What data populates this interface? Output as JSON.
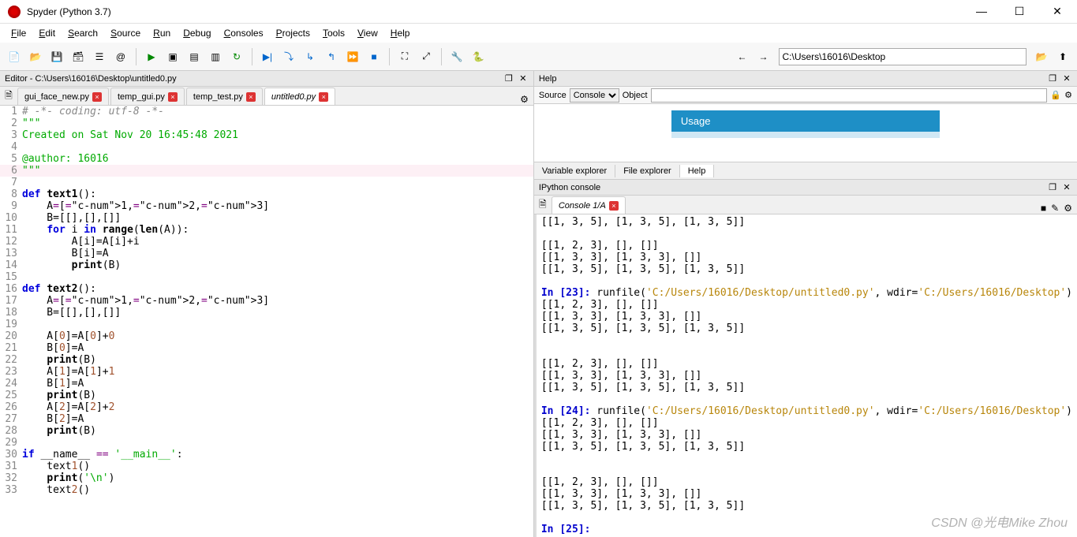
{
  "window": {
    "title": "Spyder (Python 3.7)"
  },
  "menu": [
    "File",
    "Edit",
    "Search",
    "Source",
    "Run",
    "Debug",
    "Consoles",
    "Projects",
    "Tools",
    "View",
    "Help"
  ],
  "path": "C:\\Users\\16016\\Desktop",
  "editorPane": {
    "title": "Editor - C:\\Users\\16016\\Desktop\\untitled0.py"
  },
  "editorTabs": [
    {
      "name": "gui_face_new.py",
      "active": false
    },
    {
      "name": "temp_gui.py",
      "active": false
    },
    {
      "name": "temp_test.py",
      "active": false
    },
    {
      "name": "untitled0.py",
      "active": true
    }
  ],
  "code": [
    {
      "n": 1,
      "t": "comment",
      "s": "# -*- coding: utf-8 -*-"
    },
    {
      "n": 2,
      "t": "str",
      "s": "\"\"\""
    },
    {
      "n": 3,
      "t": "str",
      "s": "Created on Sat Nov 20 16:45:48 2021"
    },
    {
      "n": 4,
      "t": "str",
      "s": ""
    },
    {
      "n": 5,
      "t": "str",
      "s": "@author: 16016"
    },
    {
      "n": 6,
      "t": "str",
      "s": "\"\"\"",
      "hl": true
    },
    {
      "n": 7,
      "t": "plain",
      "s": ""
    },
    {
      "n": 8,
      "t": "deftext1",
      "s": ""
    },
    {
      "n": 9,
      "t": "assign",
      "s": "    A=[1,2,3]"
    },
    {
      "n": 10,
      "t": "plain",
      "s": "    B=[[],[],[]]"
    },
    {
      "n": 11,
      "t": "for",
      "s": ""
    },
    {
      "n": 12,
      "t": "plain",
      "s": "        A[i]=A[i]+i"
    },
    {
      "n": 13,
      "t": "plain",
      "s": "        B[i]=A"
    },
    {
      "n": 14,
      "t": "print",
      "s": "        print(B)"
    },
    {
      "n": 15,
      "t": "plain",
      "s": ""
    },
    {
      "n": 16,
      "t": "deftext2",
      "s": ""
    },
    {
      "n": 17,
      "t": "assign",
      "s": "    A=[1,2,3]"
    },
    {
      "n": 18,
      "t": "plain",
      "s": "    B=[[],[],[]]"
    },
    {
      "n": 19,
      "t": "plain",
      "s": ""
    },
    {
      "n": 20,
      "t": "plain",
      "s": "    A[0]=A[0]+0"
    },
    {
      "n": 21,
      "t": "plain",
      "s": "    B[0]=A"
    },
    {
      "n": 22,
      "t": "print",
      "s": "    print(B)"
    },
    {
      "n": 23,
      "t": "plain",
      "s": "    A[1]=A[1]+1"
    },
    {
      "n": 24,
      "t": "plain",
      "s": "    B[1]=A"
    },
    {
      "n": 25,
      "t": "print",
      "s": "    print(B)"
    },
    {
      "n": 26,
      "t": "plain",
      "s": "    A[2]=A[2]+2"
    },
    {
      "n": 27,
      "t": "plain",
      "s": "    B[2]=A"
    },
    {
      "n": 28,
      "t": "print",
      "s": "    print(B)"
    },
    {
      "n": 29,
      "t": "plain",
      "s": ""
    },
    {
      "n": 30,
      "t": "ifmain",
      "s": ""
    },
    {
      "n": 31,
      "t": "plain",
      "s": "    text1()"
    },
    {
      "n": 32,
      "t": "printn",
      "s": ""
    },
    {
      "n": 33,
      "t": "plain",
      "s": "    text2()"
    }
  ],
  "helpPane": {
    "title": "Help"
  },
  "srcbar": {
    "sourceLabel": "Source",
    "sourceValue": "Console",
    "objectLabel": "Object"
  },
  "usage": {
    "title": "Usage"
  },
  "subtabs": [
    "Variable explorer",
    "File explorer",
    "Help"
  ],
  "ipyPane": {
    "title": "IPython console"
  },
  "ipyTabs": [
    {
      "name": "Console 1/A",
      "active": true
    }
  ],
  "console": [
    {
      "t": "out",
      "s": "[[1, 3, 5], [1, 3, 5], [1, 3, 5]]"
    },
    {
      "t": "blank",
      "s": ""
    },
    {
      "t": "out",
      "s": "[[1, 2, 3], [], []]"
    },
    {
      "t": "out",
      "s": "[[1, 3, 3], [1, 3, 3], []]"
    },
    {
      "t": "out",
      "s": "[[1, 3, 5], [1, 3, 5], [1, 3, 5]]"
    },
    {
      "t": "blank",
      "s": ""
    },
    {
      "t": "in",
      "n": 23,
      "cmd": "runfile",
      "path": "'C:/Users/16016/Desktop/untitled0.py'",
      "wdir": "'C:/Users/16016/Desktop'"
    },
    {
      "t": "out",
      "s": "[[1, 2, 3], [], []]"
    },
    {
      "t": "out",
      "s": "[[1, 3, 3], [1, 3, 3], []]"
    },
    {
      "t": "out",
      "s": "[[1, 3, 5], [1, 3, 5], [1, 3, 5]]"
    },
    {
      "t": "blank",
      "s": ""
    },
    {
      "t": "blank",
      "s": ""
    },
    {
      "t": "out",
      "s": "[[1, 2, 3], [], []]"
    },
    {
      "t": "out",
      "s": "[[1, 3, 3], [1, 3, 3], []]"
    },
    {
      "t": "out",
      "s": "[[1, 3, 5], [1, 3, 5], [1, 3, 5]]"
    },
    {
      "t": "blank",
      "s": ""
    },
    {
      "t": "in",
      "n": 24,
      "cmd": "runfile",
      "path": "'C:/Users/16016/Desktop/untitled0.py'",
      "wdir": "'C:/Users/16016/Desktop'"
    },
    {
      "t": "out",
      "s": "[[1, 2, 3], [], []]"
    },
    {
      "t": "out",
      "s": "[[1, 3, 3], [1, 3, 3], []]"
    },
    {
      "t": "out",
      "s": "[[1, 3, 5], [1, 3, 5], [1, 3, 5]]"
    },
    {
      "t": "blank",
      "s": ""
    },
    {
      "t": "blank",
      "s": ""
    },
    {
      "t": "out",
      "s": "[[1, 2, 3], [], []]"
    },
    {
      "t": "out",
      "s": "[[1, 3, 3], [1, 3, 3], []]"
    },
    {
      "t": "out",
      "s": "[[1, 3, 5], [1, 3, 5], [1, 3, 5]]"
    },
    {
      "t": "blank",
      "s": ""
    },
    {
      "t": "inempty",
      "n": 25
    }
  ],
  "watermark": "CSDN @光电Mike Zhou"
}
